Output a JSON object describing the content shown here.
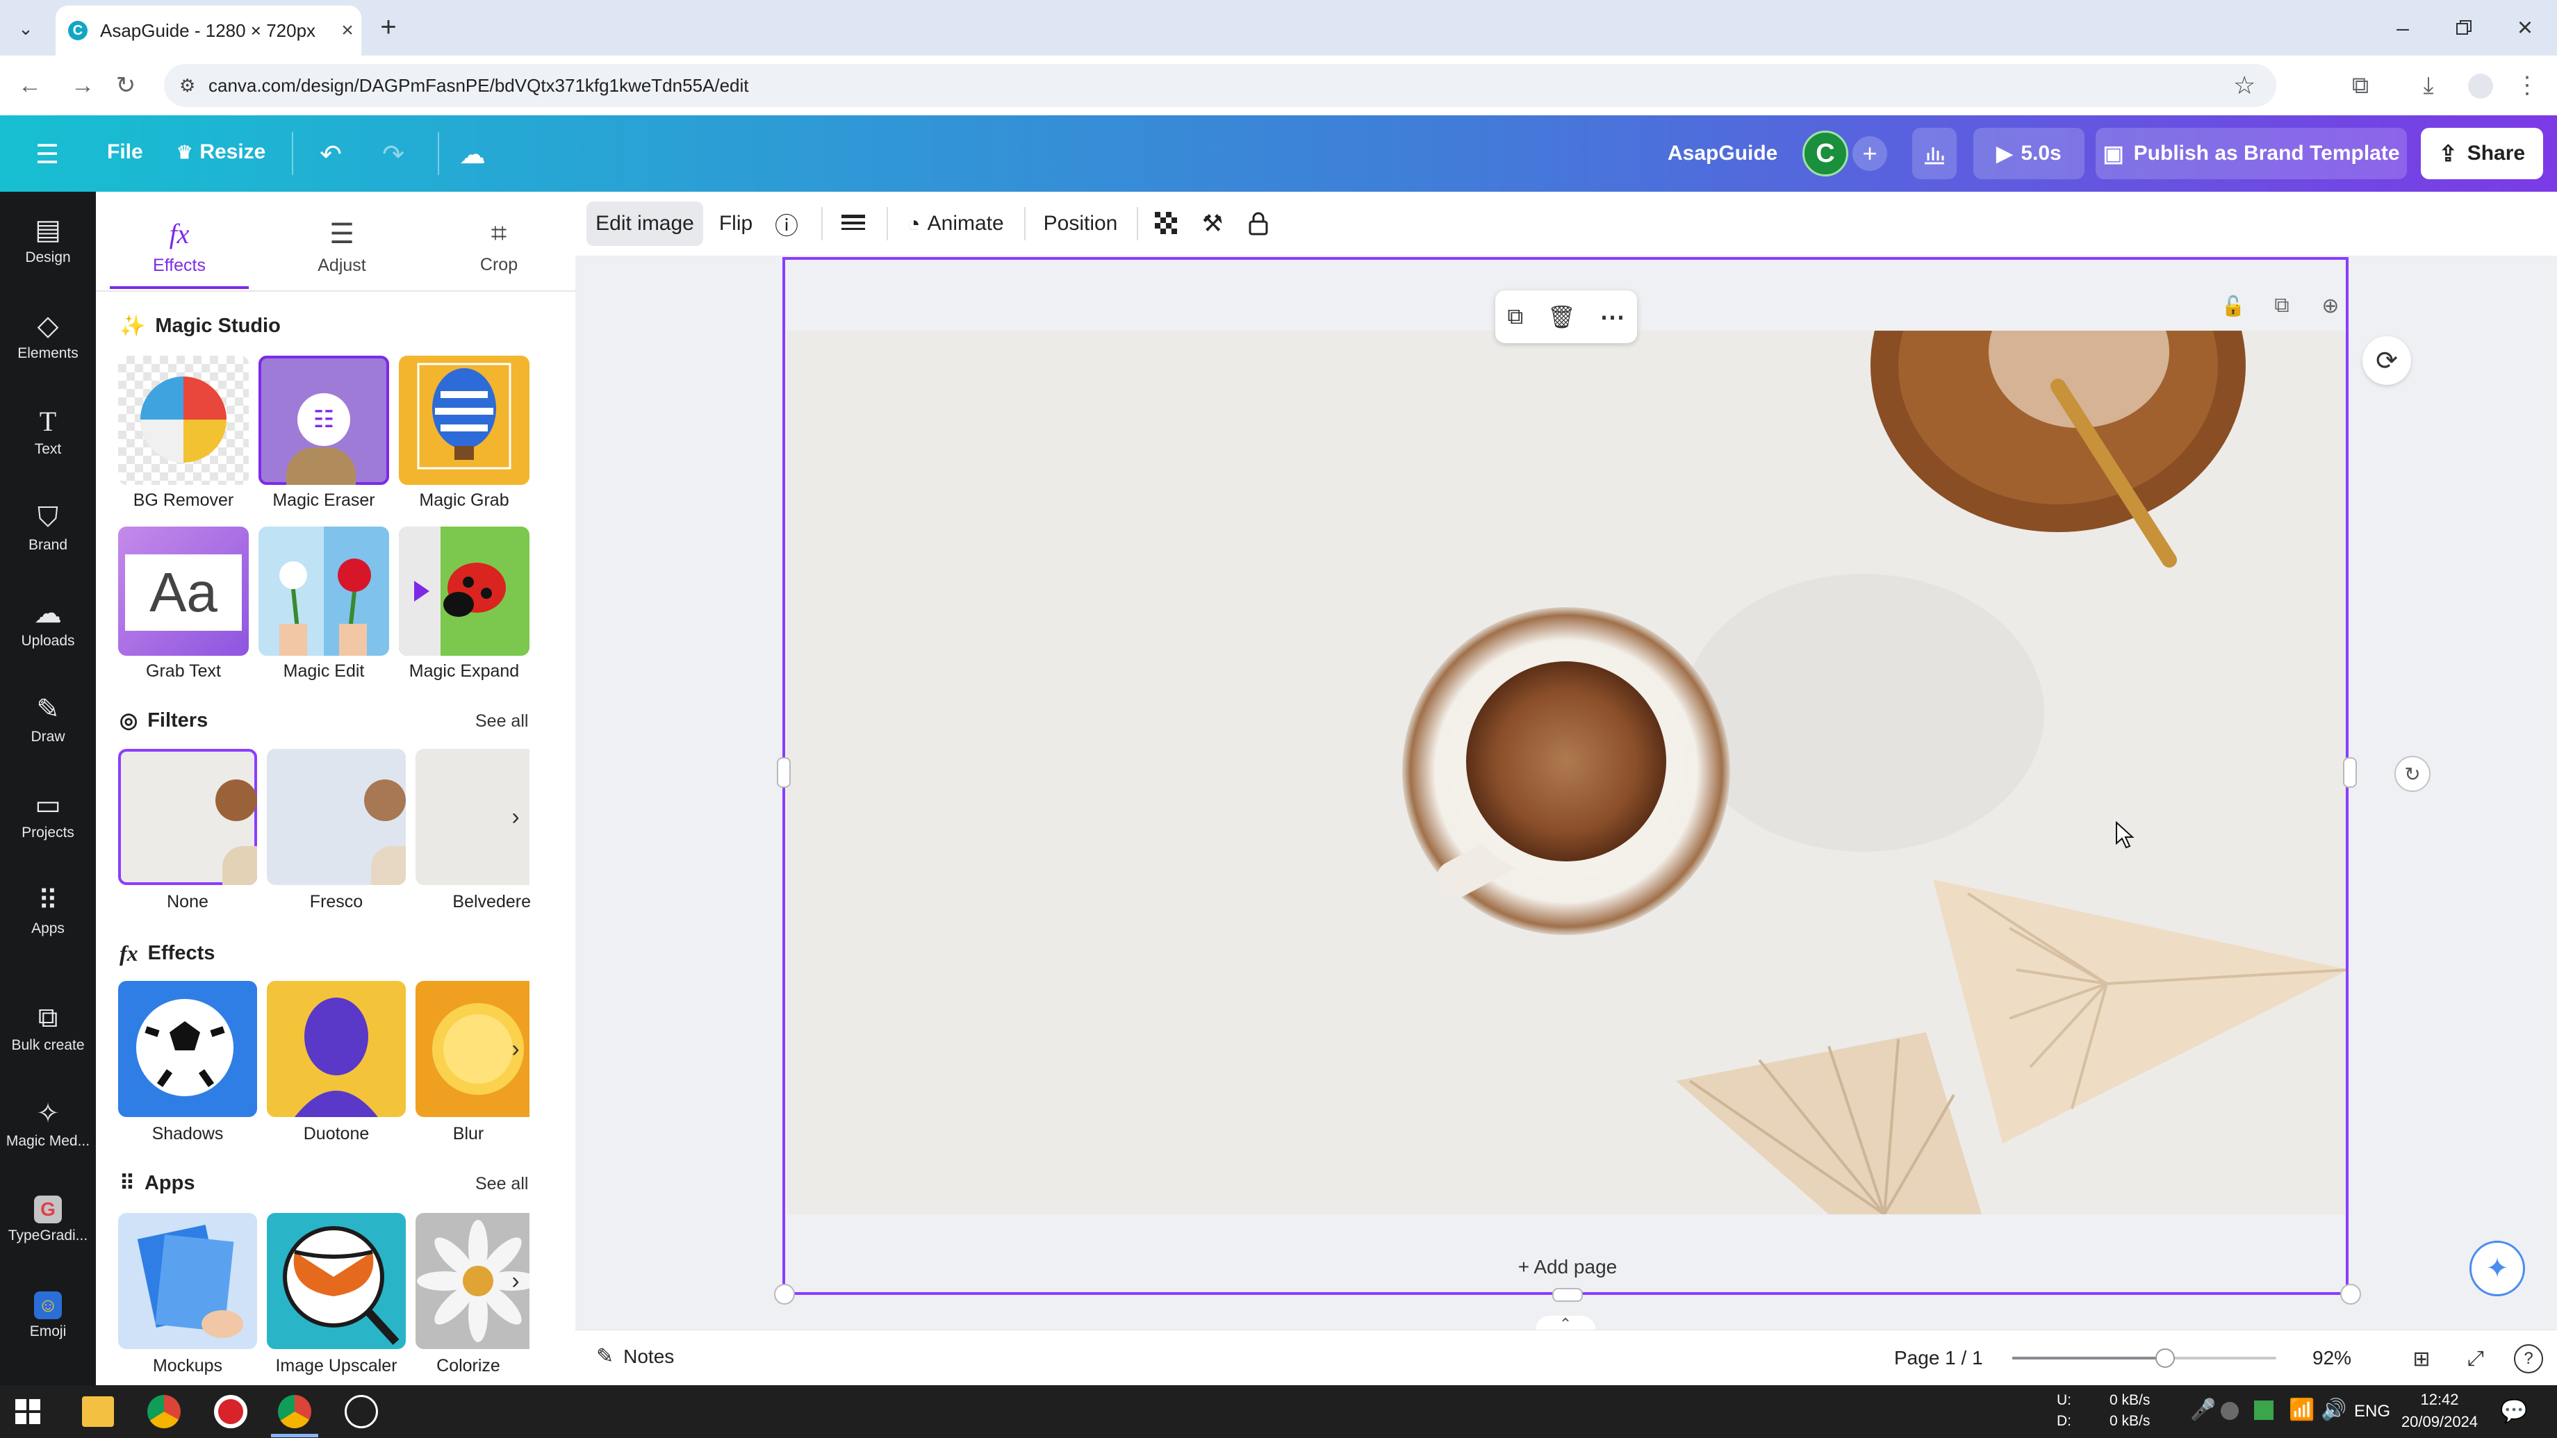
{
  "browser": {
    "tab_title": "AsapGuide - 1280 × 720px",
    "new_tab_symbol": "+",
    "url": "canva.com/design/DAGPmFasnPE/bdVQtx371kfg1kweTdn55A/edit"
  },
  "header": {
    "file_label": "File",
    "resize_label": "Resize",
    "design_name": "AsapGuide",
    "avatar_letter": "C",
    "timer_label": "5.0s",
    "publish_label": "Publish as Brand Template",
    "share_label": "Share"
  },
  "rail": {
    "items": [
      {
        "label": "Design",
        "icon": "design-icon"
      },
      {
        "label": "Elements",
        "icon": "elements-icon"
      },
      {
        "label": "Text",
        "icon": "text-icon"
      },
      {
        "label": "Brand",
        "icon": "brand-icon"
      },
      {
        "label": "Uploads",
        "icon": "uploads-icon"
      },
      {
        "label": "Draw",
        "icon": "draw-icon"
      },
      {
        "label": "Projects",
        "icon": "projects-icon"
      },
      {
        "label": "Apps",
        "icon": "apps-icon"
      },
      {
        "label": "Bulk create",
        "icon": "bulk-create-icon"
      },
      {
        "label": "Magic Med...",
        "icon": "magic-media-icon"
      },
      {
        "label": "TypeGradi...",
        "icon": "typegradient-icon"
      },
      {
        "label": "Emoji",
        "icon": "emoji-icon"
      }
    ]
  },
  "panel": {
    "tabs": [
      {
        "label": "Effects",
        "icon": "fx-icon"
      },
      {
        "label": "Adjust",
        "icon": "sliders-icon"
      },
      {
        "label": "Crop",
        "icon": "crop-icon"
      }
    ],
    "magic_studio": {
      "title": "Magic Studio",
      "tools": [
        "BG Remover",
        "Magic Eraser",
        "Magic Grab",
        "Grab Text",
        "Magic Edit",
        "Magic Expand"
      ]
    },
    "filters": {
      "title": "Filters",
      "see_all": "See all",
      "items": [
        "None",
        "Fresco",
        "Belvedere"
      ]
    },
    "effects": {
      "title": "Effects",
      "items": [
        "Shadows",
        "Duotone",
        "Blur"
      ]
    },
    "apps": {
      "title": "Apps",
      "see_all": "See all",
      "items": [
        "Mockups",
        "Image Upscaler",
        "Colorize"
      ]
    }
  },
  "toolbar": {
    "edit_image": "Edit image",
    "flip": "Flip",
    "animate": "Animate",
    "position": "Position"
  },
  "canvas": {
    "add_page": "+ Add page"
  },
  "bottombar": {
    "notes": "Notes",
    "page_indicator": "Page 1 / 1",
    "zoom": "92%",
    "zoom_level": 0.58
  },
  "taskbar": {
    "net_up_label": "U:",
    "net_down_label": "D:",
    "net_up": "0 kB/s",
    "net_down": "0 kB/s",
    "language": "ENG",
    "time": "12:42",
    "date": "20/09/2024"
  },
  "colors": {
    "selection": "#8b3dff",
    "rail_bg": "#18191b",
    "accent_gradient_start": "#17bfd2",
    "accent_gradient_end": "#7c3ae6"
  }
}
